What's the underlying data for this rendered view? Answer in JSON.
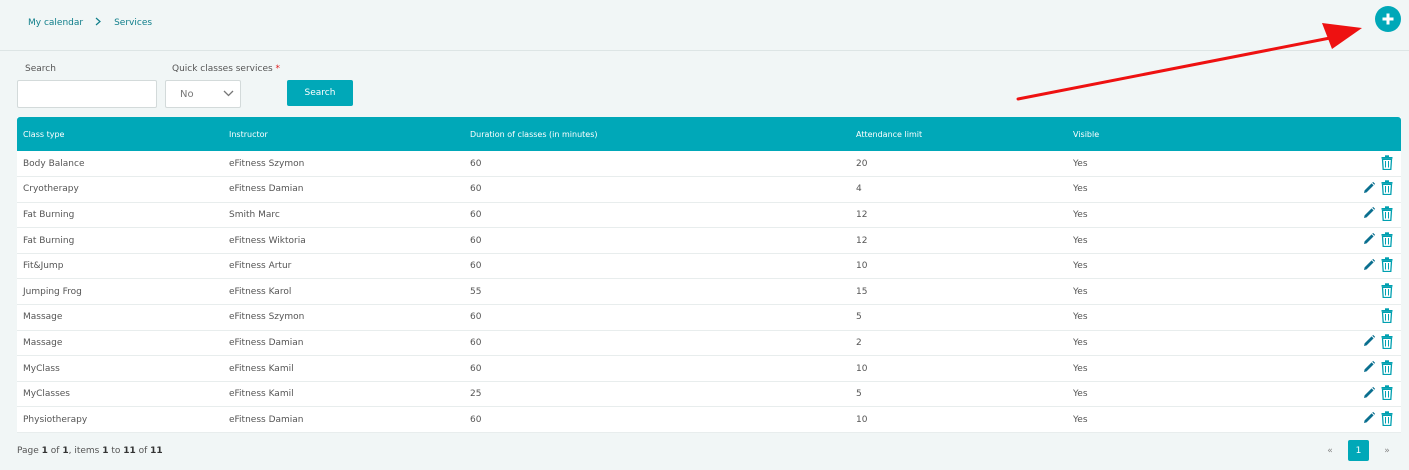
{
  "breadcrumb": {
    "home": "My calendar",
    "current": "Services"
  },
  "filters": {
    "search_label": "Search",
    "search_value": "",
    "quick_label": "Quick classes services",
    "quick_required": "*",
    "quick_value": "No",
    "search_button": "Search"
  },
  "table": {
    "headers": [
      "Class type",
      "Instructor",
      "Duration of classes (in minutes)",
      "Attendance limit",
      "Visible",
      ""
    ],
    "rows": [
      {
        "class_type": "Body Balance",
        "instructor": "eFitness Szymon",
        "duration": "60",
        "limit": "20",
        "visible": "Yes",
        "editable": false
      },
      {
        "class_type": "Cryotherapy",
        "instructor": "eFitness Damian",
        "duration": "60",
        "limit": "4",
        "visible": "Yes",
        "editable": true
      },
      {
        "class_type": "Fat Burning",
        "instructor": "Smith Marc",
        "duration": "60",
        "limit": "12",
        "visible": "Yes",
        "editable": true
      },
      {
        "class_type": "Fat Burning",
        "instructor": "eFitness Wiktoria",
        "duration": "60",
        "limit": "12",
        "visible": "Yes",
        "editable": true
      },
      {
        "class_type": "Fit&Jump",
        "instructor": "eFitness Artur",
        "duration": "60",
        "limit": "10",
        "visible": "Yes",
        "editable": true
      },
      {
        "class_type": "Jumping Frog",
        "instructor": "eFitness Karol",
        "duration": "55",
        "limit": "15",
        "visible": "Yes",
        "editable": false
      },
      {
        "class_type": "Massage",
        "instructor": "eFitness Szymon",
        "duration": "60",
        "limit": "5",
        "visible": "Yes",
        "editable": false
      },
      {
        "class_type": "Massage",
        "instructor": "eFitness Damian",
        "duration": "60",
        "limit": "2",
        "visible": "Yes",
        "editable": true
      },
      {
        "class_type": "MyClass",
        "instructor": "eFitness Kamil",
        "duration": "60",
        "limit": "10",
        "visible": "Yes",
        "editable": true
      },
      {
        "class_type": "MyClasses",
        "instructor": "eFitness Kamil",
        "duration": "25",
        "limit": "5",
        "visible": "Yes",
        "editable": true
      },
      {
        "class_type": "Physiotherapy",
        "instructor": "eFitness Damian",
        "duration": "60",
        "limit": "10",
        "visible": "Yes",
        "editable": true
      }
    ]
  },
  "pagination": {
    "text_page": "Page ",
    "page": "1",
    "text_of": " of ",
    "pages": "1",
    "text_items": ", items ",
    "from": "1",
    "text_to": " to ",
    "to": "11",
    "text_of2": " of ",
    "total": "11",
    "prev": "«",
    "current": "1",
    "next": "»"
  },
  "icons": {
    "add": "plus-icon",
    "chevron": "chevron-down-icon",
    "edit": "pencil-icon",
    "delete": "trash-icon",
    "separator": "chevron-right-icon"
  },
  "colors": {
    "accent": "#00a8b8",
    "annotation_arrow": "#ee1111"
  }
}
